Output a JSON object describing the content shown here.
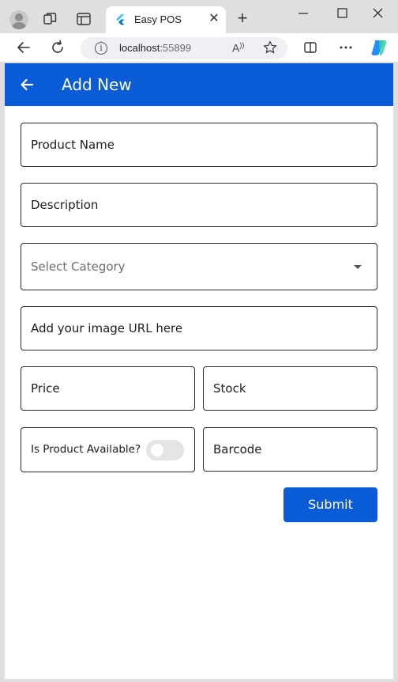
{
  "browser": {
    "tab_title": "Easy POS",
    "url_host": "localhost",
    "url_port": ":55899"
  },
  "app": {
    "title": "Add New"
  },
  "form": {
    "product_name_label": "Product Name",
    "description_label": "Description",
    "category_placeholder": "Select Category",
    "image_url_label": "Add your image URL here",
    "price_label": "Price",
    "stock_label": "Stock",
    "available_label": "Is Product Available?",
    "available_value": false,
    "barcode_label": "Barcode",
    "submit_label": "Submit"
  },
  "colors": {
    "primary": "#0a5bd6"
  }
}
